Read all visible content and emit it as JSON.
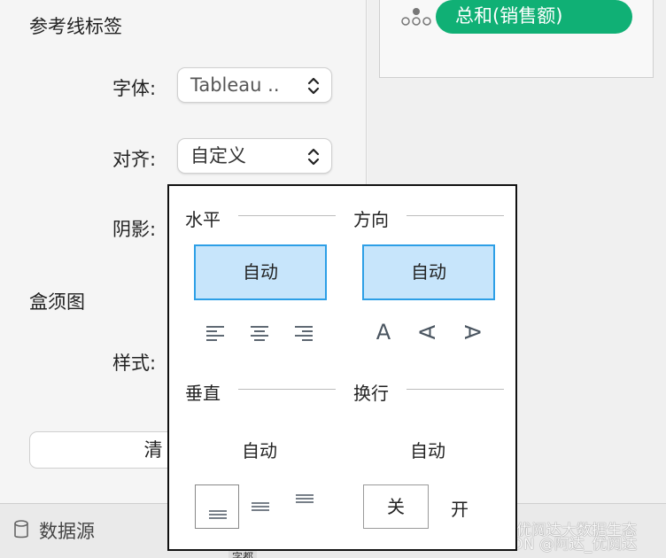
{
  "left": {
    "ref_line_label_title": "参考线标签",
    "font_label": "字体:",
    "font_value": "Tableau ..",
    "align_label": "对齐:",
    "align_value": "自定义",
    "shadow_label": "阴影:",
    "boxplot_title": "盒须图",
    "style_label": "样式:",
    "clear_button_partial": "清"
  },
  "right": {
    "measure_pill": "总和(销售额)"
  },
  "bottom": {
    "data_source": "数据源",
    "partial_tab": "字都",
    "watermark_line1": "优阅达大数据生态",
    "watermark_line2": "CSDN @阿达_优阅达"
  },
  "popup": {
    "horizontal": {
      "title": "水平",
      "auto": "自动",
      "icons": [
        "align-left-icon",
        "align-center-icon",
        "align-right-icon"
      ]
    },
    "direction": {
      "title": "方向",
      "auto": "自动",
      "letters": [
        "A",
        "A",
        "A"
      ]
    },
    "vertical": {
      "title": "垂直",
      "auto": "自动",
      "icons": [
        "valign-bottom-icon",
        "valign-middle-icon",
        "valign-top-icon"
      ]
    },
    "wrap": {
      "title": "换行",
      "auto": "自动",
      "off": "关",
      "on": "开"
    }
  },
  "colors": {
    "accent_blue": "#2d9fe6",
    "selected_fill": "#c7e5fb",
    "pill_green": "#10b075"
  }
}
